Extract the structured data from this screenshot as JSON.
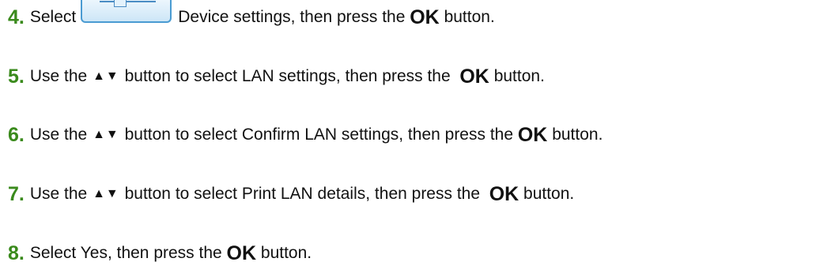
{
  "steps": [
    {
      "num": "4.",
      "pre": "Select",
      "icon": "device-settings-icon",
      "post": "Device settings, then press the",
      "ok": "OK",
      "end": "button."
    },
    {
      "num": "5.",
      "pre": "Use the",
      "arrows": "▲▼",
      "post": "button to select LAN settings, then press the",
      "ok": "OK",
      "end": "button."
    },
    {
      "num": "6.",
      "pre": "Use the",
      "arrows": "▲▼",
      "post": "button to select Confirm LAN settings, then press the",
      "ok": "OK",
      "end": "button."
    },
    {
      "num": "7.",
      "pre": "Use the",
      "arrows": "▲▼",
      "post": "button to select Print LAN details, then press the",
      "ok": "OK",
      "end": "button."
    },
    {
      "num": "8.",
      "pre": "Select Yes, then press the",
      "ok": "OK",
      "end": "button."
    }
  ],
  "colors": {
    "step_number": "#3a8a1c",
    "text": "#111111",
    "icon_border": "#4a9bd2"
  }
}
